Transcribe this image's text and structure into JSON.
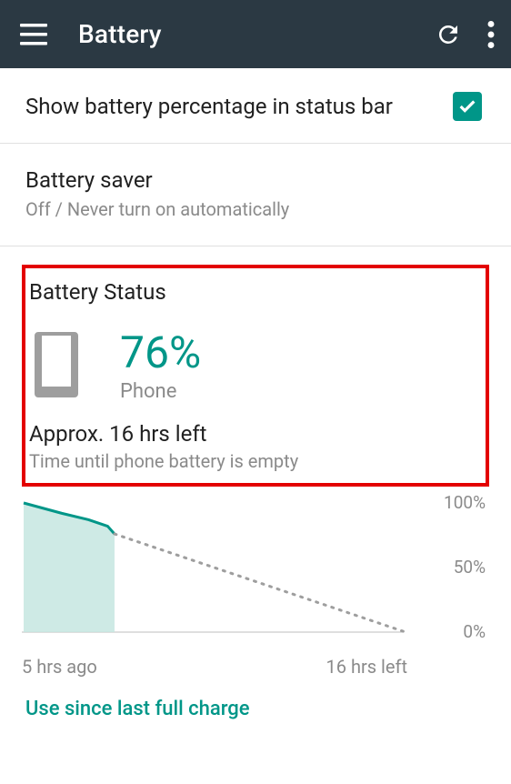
{
  "toolbar": {
    "title": "Battery"
  },
  "show_pct": {
    "label": "Show battery percentage in status bar",
    "checked": true
  },
  "saver": {
    "title": "Battery saver",
    "subtitle": "Off / Never turn on automatically"
  },
  "status": {
    "heading": "Battery Status",
    "percent": "76%",
    "device": "Phone",
    "approx": "Approx. 16 hrs left",
    "approx_sub": "Time until phone battery is empty"
  },
  "chart_data": {
    "type": "area",
    "ylim": [
      0,
      100
    ],
    "yticks": [
      "100%",
      "50%",
      "0%"
    ],
    "x_left_label": "5 hrs ago",
    "x_right_label": "16 hrs left",
    "history_fraction_of_width": 0.238,
    "history": [
      {
        "t": 0.0,
        "pct": 100
      },
      {
        "t": 0.1,
        "pct": 92
      },
      {
        "t": 0.17,
        "pct": 87
      },
      {
        "t": 0.22,
        "pct": 82
      },
      {
        "t": 0.238,
        "pct": 76
      }
    ],
    "projection": [
      {
        "t": 0.238,
        "pct": 76
      },
      {
        "t": 1.0,
        "pct": 0
      }
    ]
  },
  "time": {
    "left": "5 hrs ago",
    "right": "16 hrs left"
  },
  "link": {
    "label": "Use since last full charge"
  },
  "colors": {
    "accent": "#009688",
    "toolbar": "#2b3943",
    "annotation": "#e30000"
  }
}
